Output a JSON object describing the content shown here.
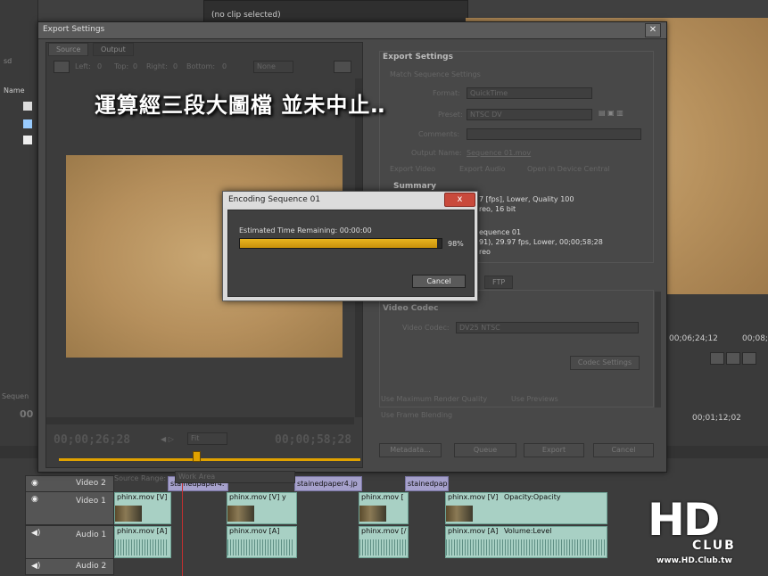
{
  "app": {
    "no_clip_label": "(no clip selected)",
    "left_panel_label": "Name",
    "left_tab_label": "sd",
    "right_tc1": "00;06;24;12",
    "right_tc2": "00;08;3",
    "right_tc3": "00;01;12;02",
    "sequence_label": "Sequen",
    "left_tc": "00"
  },
  "overlay_caption": "運算經三段大圖檔  並未中止‥",
  "export_dialog": {
    "title": "Export Settings",
    "tabs": [
      "Source",
      "Output"
    ],
    "crop": {
      "left_label": "Left:",
      "left_value": "0",
      "top_label": "Top:",
      "top_value": "0",
      "right_label": "Right:",
      "right_value": "0",
      "bottom_label": "Bottom:",
      "bottom_value": "0",
      "mode": "None"
    },
    "timecode_in": "00;00;26;28",
    "timecode_out": "00;00;58;28",
    "fit": "Fit",
    "source_range_label": "Source Range:",
    "source_range_value": "Work Area",
    "settings": {
      "heading": "Export Settings",
      "match_sequence": "Match Sequence Settings",
      "format_label": "Format:",
      "format_value": "QuickTime",
      "preset_label": "Preset:",
      "preset_value": "NTSC DV",
      "comments_label": "Comments:",
      "output_name_label": "Output Name:",
      "output_name_value": "Sequence 01.mov",
      "export_video": "Export Video",
      "export_audio": "Export Audio",
      "open_device_central": "Open in Device Central",
      "summary_heading": "Summary",
      "summary_line1": "7 [fps], Lower, Quality 100",
      "summary_line2": "reo, 16 bit",
      "summary_line3": "equence 01",
      "summary_line4": "91), 29.97 fps, Lower, 00;00;58;28",
      "summary_line5": "reo",
      "ftp_tab": "FTP",
      "video_codec_heading": "Video Codec",
      "video_codec_label": "Video Codec:",
      "video_codec_value": "DV25 NTSC",
      "codec_settings_btn": "Codec Settings",
      "use_max_quality": "Use Maximum Render Quality",
      "use_previews": "Use Previews",
      "use_frame_blending": "Use Frame Blending",
      "metadata_btn": "Metadata...",
      "queue_btn": "Queue",
      "export_btn": "Export",
      "cancel_btn": "Cancel"
    }
  },
  "encoding_dialog": {
    "title": "Encoding Sequence 01",
    "close_label": "x",
    "time_remaining_label": "Estimated Time Remaining: 00:00:00",
    "progress_percent": 98,
    "progress_text": "98%",
    "cancel_label": "Cancel"
  },
  "timeline": {
    "tracks": [
      {
        "name": "Video 2"
      },
      {
        "name": "Video 1"
      },
      {
        "name": "Audio 1"
      },
      {
        "name": "Audio 2"
      }
    ],
    "video2_clips": [
      "stainedpaper4.",
      "stainedpaper4.jp",
      "stainedpap"
    ],
    "video1_clips": [
      "phinx.mov [V]",
      "phinx.mov [V]",
      "phinx.mov [",
      "phinx.mov [V]"
    ],
    "video1_labels": [
      "y",
      "Opacity:Opacity"
    ],
    "audio1_clips": [
      "phinx.mov [A]",
      "phinx.mov [A]",
      "phinx.mov [/",
      "phinx.mov [A]"
    ],
    "audio1_labels": [
      "Volume:Level"
    ]
  },
  "logo": {
    "big": "HD",
    "club": "CLUB",
    "url": "www.HD.Club.tw"
  }
}
